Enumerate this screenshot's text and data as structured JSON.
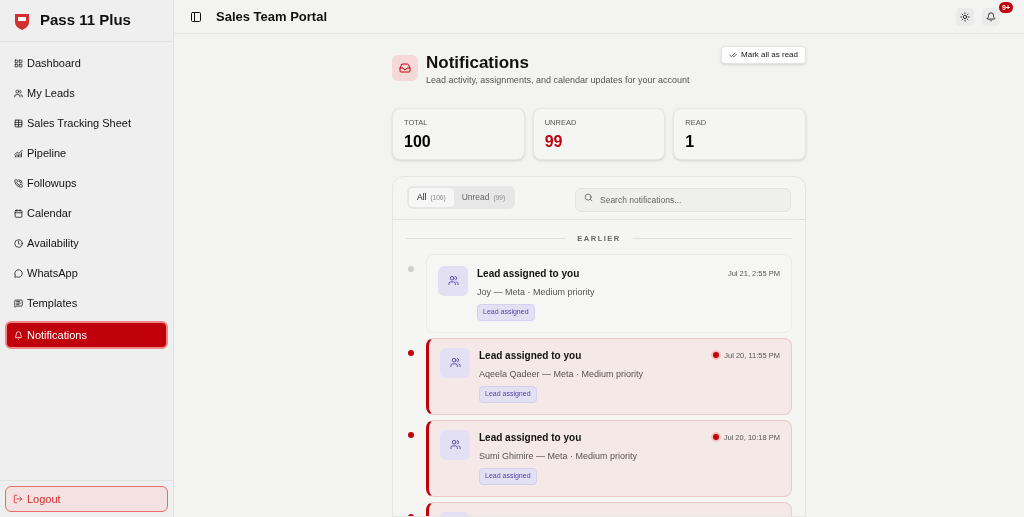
{
  "brand": {
    "name": "Pass 11 Plus"
  },
  "sidebar": {
    "items": [
      {
        "label": "Dashboard",
        "selected": false
      },
      {
        "label": "My Leads",
        "selected": false
      },
      {
        "label": "Sales Tracking Sheet",
        "selected": false
      },
      {
        "label": "Pipeline",
        "selected": false
      },
      {
        "label": "Followups",
        "selected": false
      },
      {
        "label": "Calendar",
        "selected": false
      },
      {
        "label": "Availability",
        "selected": false
      },
      {
        "label": "WhatsApp",
        "selected": false
      },
      {
        "label": "Templates",
        "selected": false
      },
      {
        "label": "Notifications",
        "selected": true
      }
    ],
    "logout": "Logout"
  },
  "header": {
    "title": "Sales Team Portal",
    "badge": "9+"
  },
  "page": {
    "title": "Notifications",
    "subtitle": "Lead activity, assignments, and calendar updates for your account",
    "mark_all": "Mark all as read"
  },
  "stats": [
    {
      "label": "TOTAL",
      "value": "100",
      "kind": "total"
    },
    {
      "label": "UNREAD",
      "value": "99",
      "kind": "unread"
    },
    {
      "label": "READ",
      "value": "1",
      "kind": "read"
    }
  ],
  "filters": [
    {
      "label": "All",
      "count": "(100)",
      "selected": true
    },
    {
      "label": "Unread",
      "count": "(99)",
      "selected": false
    }
  ],
  "search": {
    "placeholder": "Search notifications..."
  },
  "section": "EARLIER",
  "notifications": [
    {
      "title": "Lead assigned to you",
      "detail": "Joy — Meta · Medium priority",
      "tag": "Lead assigned",
      "time": "Jul 21, 2:55 PM",
      "unread": false
    },
    {
      "title": "Lead assigned to you",
      "detail": "Aqeela Qadeer — Meta · Medium priority",
      "tag": "Lead assigned",
      "time": "Jul 20, 11:55 PM",
      "unread": true
    },
    {
      "title": "Lead assigned to you",
      "detail": "Sumi Ghimire — Meta · Medium priority",
      "tag": "Lead assigned",
      "time": "Jul 20, 10:18 PM",
      "unread": true
    },
    {
      "unread": true
    }
  ]
}
